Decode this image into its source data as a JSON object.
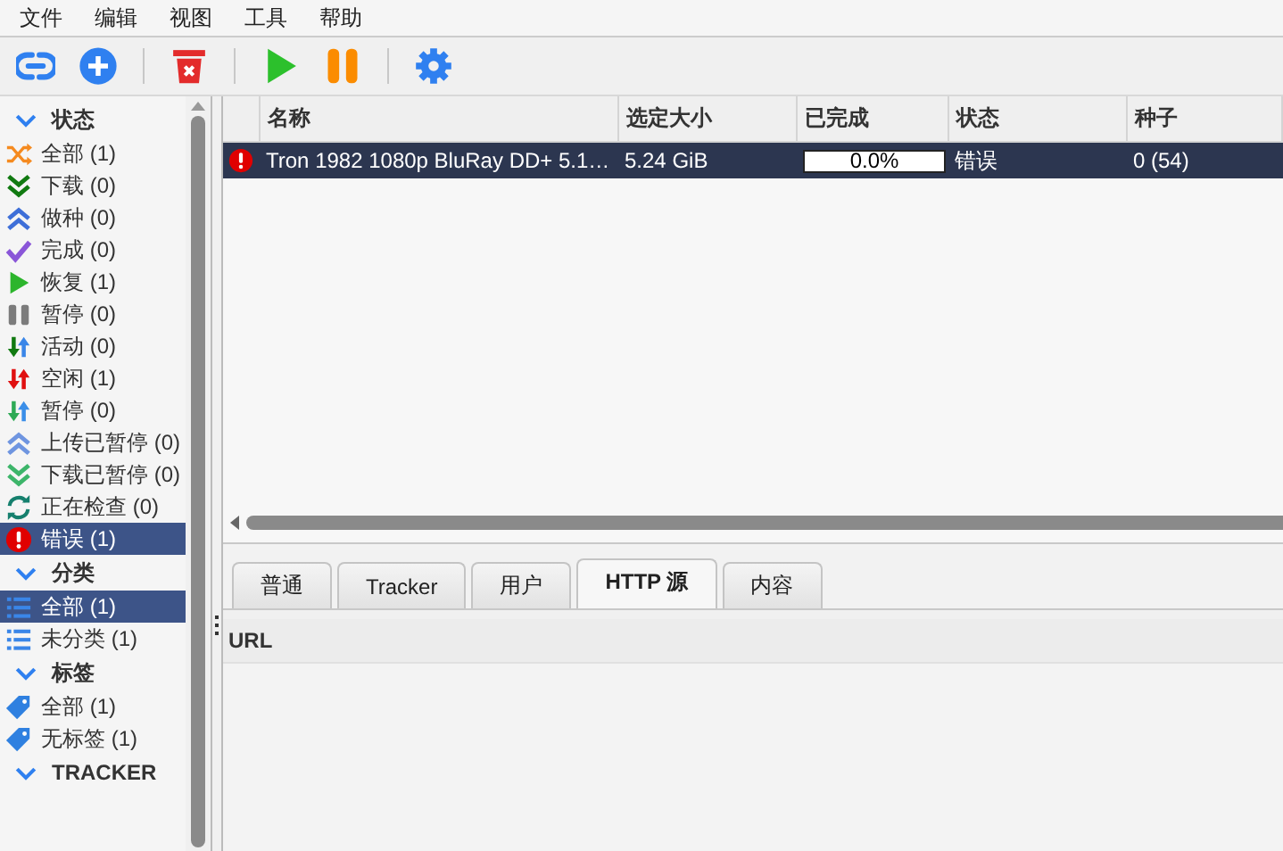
{
  "menu": [
    {
      "label": "文件"
    },
    {
      "label": "编辑"
    },
    {
      "label": "视图"
    },
    {
      "label": "工具"
    },
    {
      "label": "帮助"
    }
  ],
  "toolbar": [
    {
      "kind": "add-link"
    },
    {
      "kind": "add"
    },
    {
      "kind": "separator"
    },
    {
      "kind": "delete"
    },
    {
      "kind": "separator"
    },
    {
      "kind": "resume"
    },
    {
      "kind": "pause"
    },
    {
      "kind": "separator"
    },
    {
      "kind": "settings"
    }
  ],
  "sidebar": {
    "sections": [
      {
        "title": "状态",
        "expanded": true,
        "items": [
          {
            "label": "全部 (1)",
            "kind": "all",
            "selected": false
          },
          {
            "label": "下载 (0)",
            "kind": "downloading",
            "selected": false
          },
          {
            "label": "做种 (0)",
            "kind": "seeding",
            "selected": false
          },
          {
            "label": "完成 (0)",
            "kind": "completed",
            "selected": false
          },
          {
            "label": "恢复 (1)",
            "kind": "resumed",
            "selected": false
          },
          {
            "label": "暂停 (0)",
            "kind": "paused",
            "selected": false
          },
          {
            "label": "活动 (0)",
            "kind": "active",
            "selected": false
          },
          {
            "label": "空闲 (1)",
            "kind": "inactive",
            "selected": false
          },
          {
            "label": "暂停 (0)",
            "kind": "stalled",
            "selected": false
          },
          {
            "label": "上传已暂停 (0)",
            "kind": "upload-paused",
            "selected": false
          },
          {
            "label": "下载已暂停 (0)",
            "kind": "download-paused",
            "selected": false
          },
          {
            "label": "正在检查 (0)",
            "kind": "checking",
            "selected": false
          },
          {
            "label": "错误 (1)",
            "kind": "error",
            "selected": true
          }
        ]
      },
      {
        "title": "分类",
        "expanded": true,
        "items": [
          {
            "label": "全部 (1)",
            "kind": "list",
            "selected": true
          },
          {
            "label": "未分类 (1)",
            "kind": "list",
            "selected": false
          }
        ]
      },
      {
        "title": "标签",
        "expanded": true,
        "items": [
          {
            "label": "全部 (1)",
            "kind": "tag",
            "selected": false
          },
          {
            "label": "无标签 (1)",
            "kind": "tag",
            "selected": false
          }
        ]
      },
      {
        "title": "TRACKER",
        "expanded": true
      }
    ]
  },
  "table": {
    "columns": [
      "名称",
      "选定大小",
      "已完成",
      "状态",
      "种子"
    ],
    "rows": [
      {
        "kind": "error",
        "selected": true,
        "name": "Tron 1982 1080p BluRay DD+ 5.1…",
        "size": "5.24 GiB",
        "progress": {
          "level": 0,
          "text": "0.0%"
        },
        "status": "错误",
        "seeds": "0 (54)"
      }
    ]
  },
  "details": {
    "tabs": [
      {
        "label": "普通",
        "selected": false
      },
      {
        "label": "Tracker",
        "selected": false
      },
      {
        "label": "用户",
        "selected": false
      },
      {
        "label": "HTTP 源",
        "selected": true
      },
      {
        "label": "内容",
        "selected": false
      }
    ],
    "columns": [
      "URL"
    ]
  }
}
